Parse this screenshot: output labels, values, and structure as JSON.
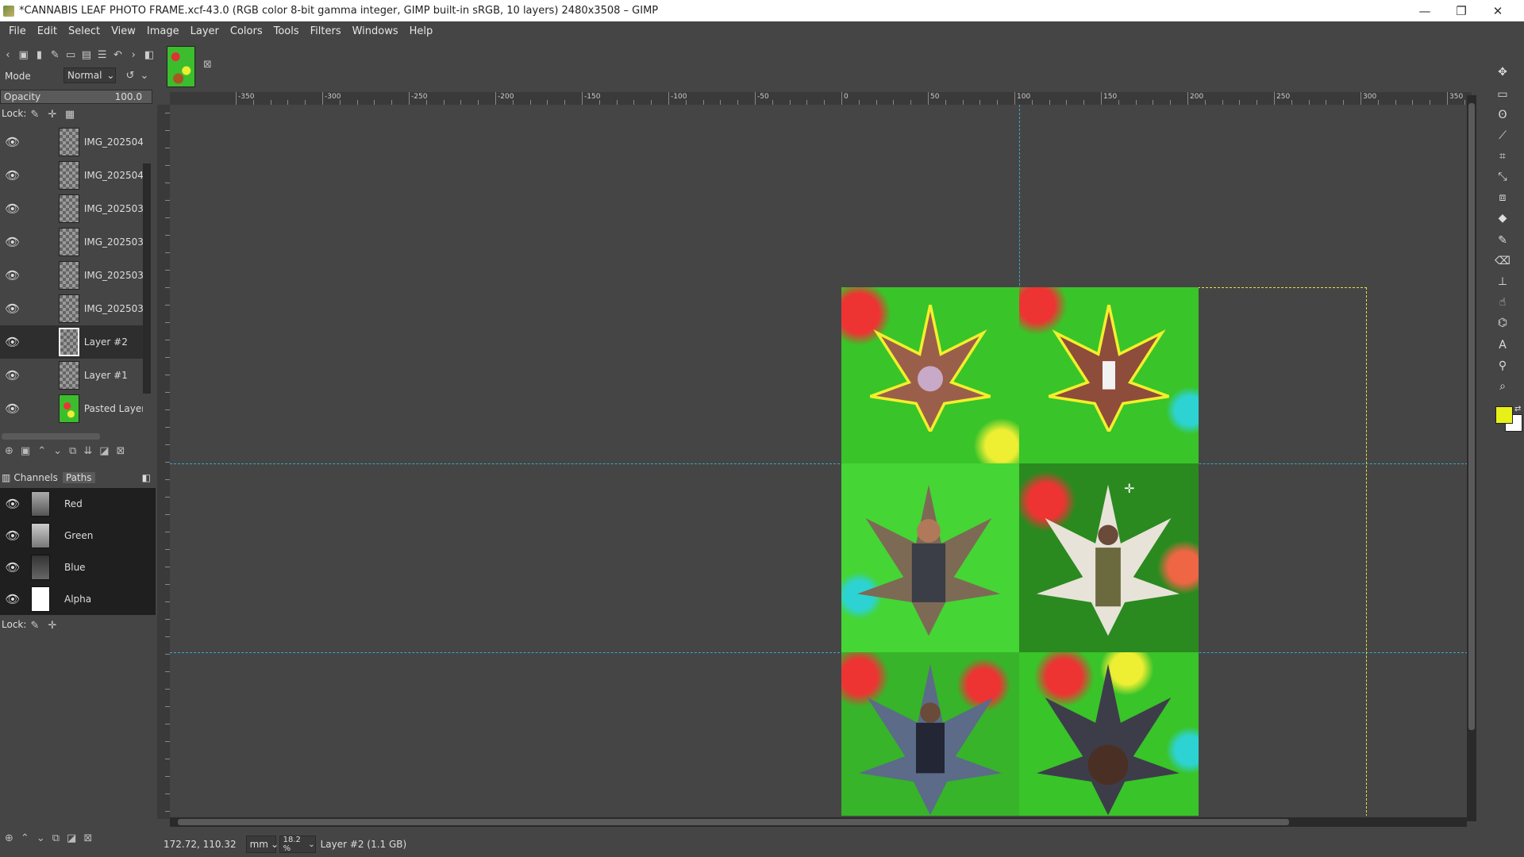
{
  "window": {
    "title": "*CANNABIS LEAF PHOTO FRAME.xcf-43.0 (RGB color 8-bit gamma integer, GIMP built-in sRGB, 10 layers) 2480x3508 – GIMP",
    "minimize": "—",
    "maximize": "❐",
    "close": "✕"
  },
  "menu": [
    "File",
    "Edit",
    "Select",
    "View",
    "Image",
    "Layer",
    "Colors",
    "Tools",
    "Filters",
    "Windows",
    "Help"
  ],
  "layers_panel": {
    "mode_label": "Mode",
    "mode_value": "Normal",
    "opacity_label": "Opacity",
    "opacity_value": "100.0",
    "lock_label": "Lock:",
    "layers": [
      {
        "name": "IMG_202504",
        "visible": true
      },
      {
        "name": "IMG_202504",
        "visible": true
      },
      {
        "name": "IMG_202503",
        "visible": true
      },
      {
        "name": "IMG_202503",
        "visible": true
      },
      {
        "name": "IMG_202503",
        "visible": true
      },
      {
        "name": "IMG_202503",
        "visible": true
      },
      {
        "name": "Layer #2",
        "visible": true,
        "selected": true
      },
      {
        "name": "Layer #1",
        "visible": true
      },
      {
        "name": "Pasted Layer",
        "visible": true
      }
    ]
  },
  "channels_panel": {
    "tab_channels": "Channels",
    "tab_paths": "Paths",
    "lock_label": "Lock:",
    "channels": [
      {
        "name": "Red"
      },
      {
        "name": "Green"
      },
      {
        "name": "Blue"
      },
      {
        "name": "Alpha"
      }
    ]
  },
  "ruler": {
    "labels": [
      "-350",
      "-300",
      "-250",
      "-200",
      "-150",
      "-100",
      "-50",
      "0",
      "50",
      "100",
      "150",
      "200",
      "250",
      "300",
      "350"
    ]
  },
  "statusbar": {
    "coords": "172.72, 110.32",
    "unit": "mm",
    "zoom": "18.2 %",
    "layer_info": "Layer #2 (1.1 GB)"
  },
  "colors": {
    "foreground": "#e8f01a",
    "background": "#ffffff",
    "guide": "#3aa7c9",
    "layer_boundary": "#e7e23a"
  }
}
